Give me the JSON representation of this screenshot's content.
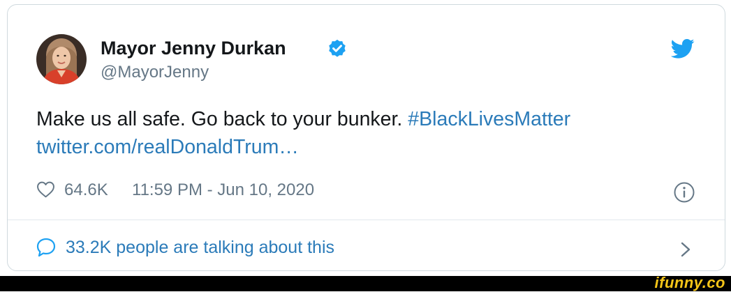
{
  "tweet": {
    "display_name": "Mayor Jenny Durkan",
    "handle": "@MayorJenny",
    "verified": true,
    "text_plain": "Make us all safe. Go back to your bunker. ",
    "hashtag": "#BlackLivesMatter",
    "url_text": "twitter.com/realDonaldTrum…",
    "likes": "64.6K",
    "timestamp": "11:59 PM - Jun 10, 2020",
    "talking": "33.2K people are talking about this"
  },
  "icons": {
    "verified": "verified-badge-icon",
    "bird": "twitter-bird-icon",
    "heart": "heart-outline-icon",
    "info": "info-circle-icon",
    "reply": "speech-bubble-icon",
    "chevron": "chevron-right-icon"
  },
  "colors": {
    "link": "#2b7bb9",
    "twitter_blue": "#1da1f2",
    "secondary_text": "#657786",
    "border": "#cfd9de",
    "watermark": "#f5c518"
  },
  "watermark": "ifunny.co"
}
